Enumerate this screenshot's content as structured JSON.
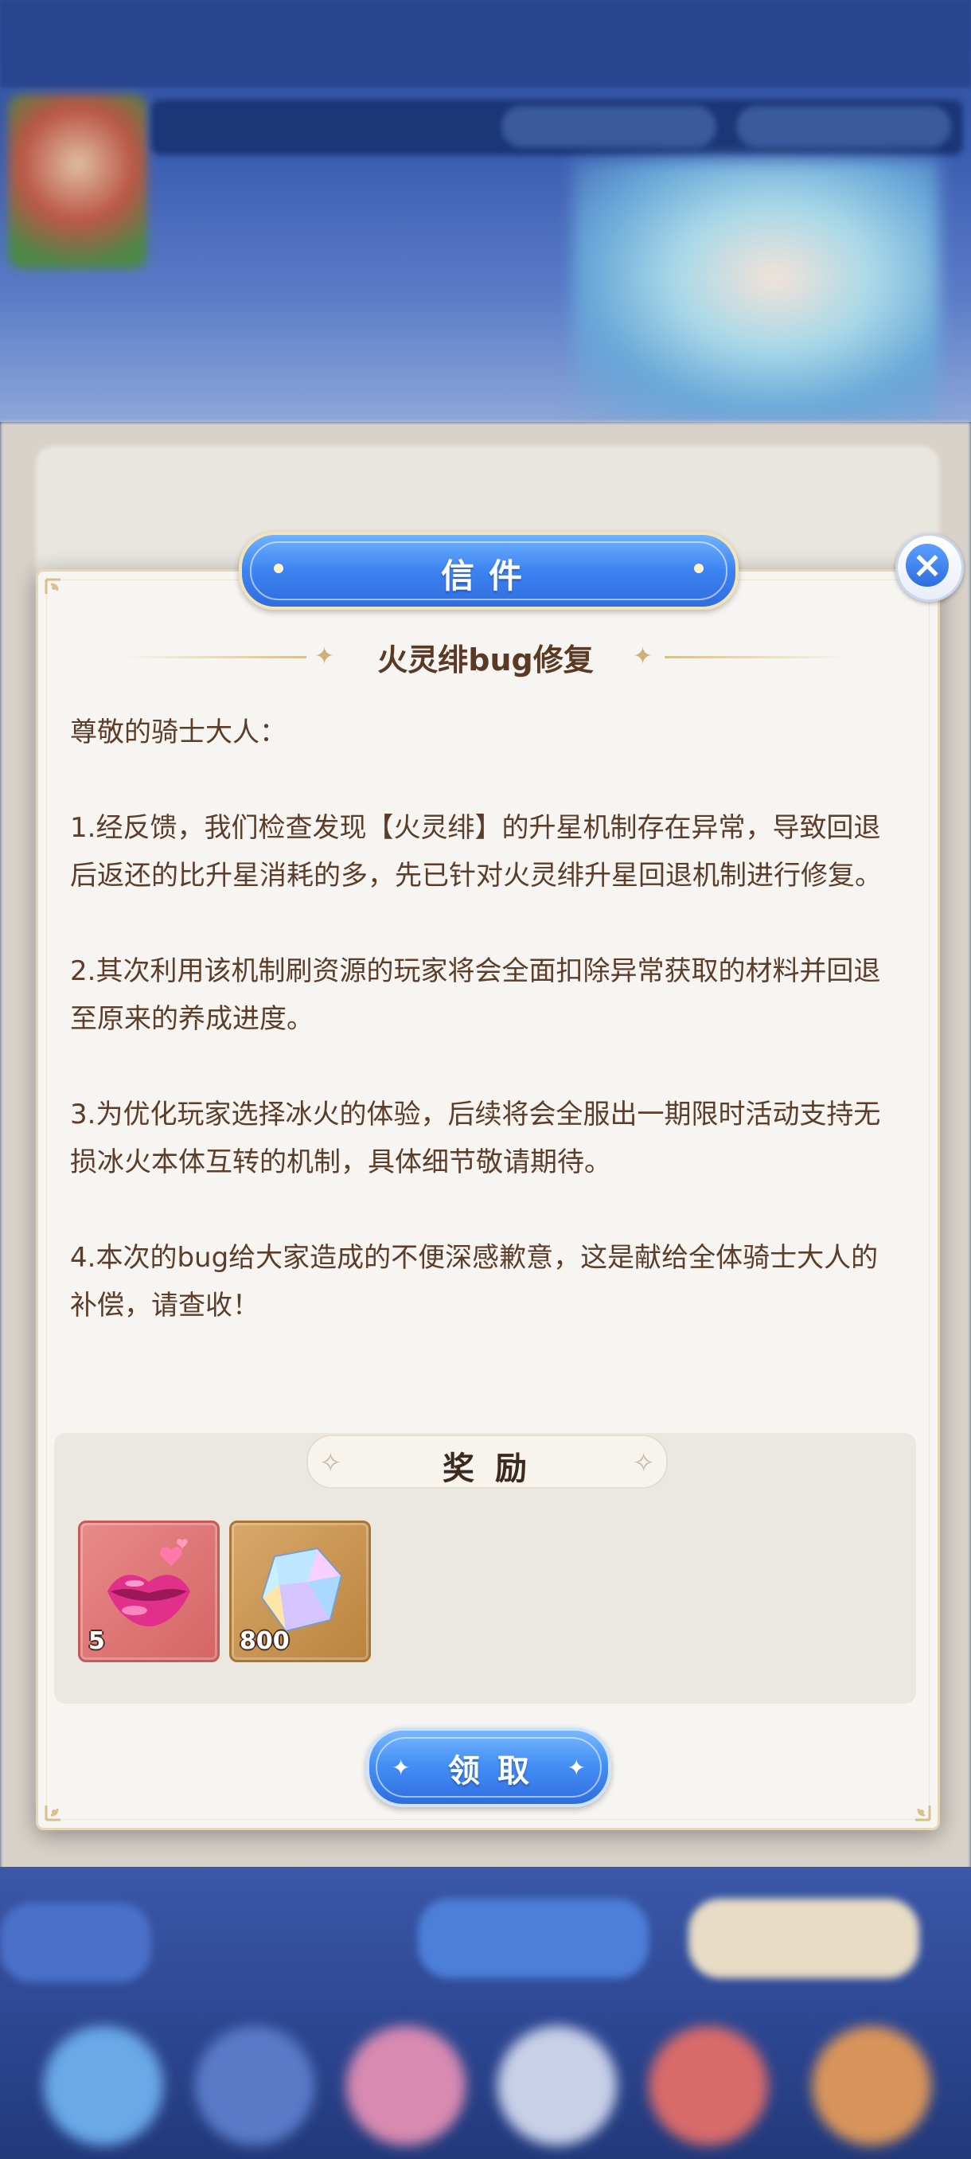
{
  "modal": {
    "title": "信件",
    "close_label": "×",
    "subject": "火灵绯bug修复",
    "body": {
      "greeting": "尊敬的骑士大人：",
      "paragraphs": [
        "1.经反馈，我们检查发现【火灵绯】的升星机制存在异常，导致回退后返还的比升星消耗的多，先已针对火灵绯升星回退机制进行修复。",
        "2.其次利用该机制刷资源的玩家将会全面扣除异常获取的材料并回退至原来的养成进度。",
        "3.为优化玩家选择冰火的体验，后续将会全服出一期限时活动支持无损冰火本体互转的机制，具体细节敬请期待。",
        "4.本次的bug给大家造成的不便深感歉意，这是献给全体骑士大人的补偿，请查收！"
      ]
    },
    "rewards": {
      "title": "奖励",
      "items": [
        {
          "icon": "lips-icon",
          "count": "5",
          "color": "#e07878"
        },
        {
          "icon": "crystal-icon",
          "count": "800",
          "color": "#c99552"
        }
      ]
    },
    "claim_label": "领取"
  },
  "colors": {
    "accent_blue": "#3d83f0",
    "modal_bg": "#f7f5f1",
    "text_brown": "#5b3d2a",
    "gold_border": "#e6d7b8"
  }
}
